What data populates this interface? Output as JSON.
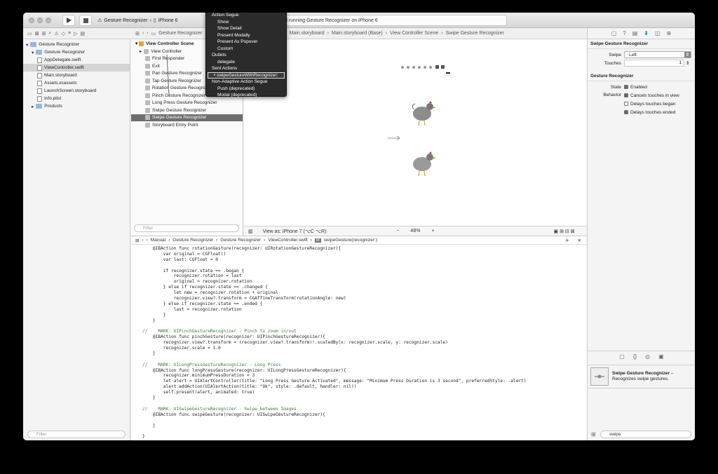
{
  "window": {
    "scheme_project": "Gesture Recognizer",
    "scheme_device": "iPhone 6",
    "status": "d running Gesture Recognizer on iPhone 6"
  },
  "jumpbar_top": {
    "project": "Gesture Recognizer",
    "path": [
      "Main.storyboard",
      "Main.storyboard (Base)",
      "View Controller Scene",
      "Swipe Gesture Recognizer"
    ]
  },
  "navigator": {
    "items": [
      {
        "label": "Gesture Recognizer",
        "level": 0,
        "kind": "project"
      },
      {
        "label": "Gesture Recognizer",
        "level": 1,
        "kind": "folder"
      },
      {
        "label": "AppDelegate.swift",
        "level": 2,
        "kind": "file"
      },
      {
        "label": "ViewController.swift",
        "level": 2,
        "kind": "file",
        "selected": true
      },
      {
        "label": "Main.storyboard",
        "level": 2,
        "kind": "file"
      },
      {
        "label": "Assets.xcassets",
        "level": 2,
        "kind": "file"
      },
      {
        "label": "LaunchScreen.storyboard",
        "level": 2,
        "kind": "file"
      },
      {
        "label": "Info.plist",
        "level": 2,
        "kind": "file"
      },
      {
        "label": "Products",
        "level": 1,
        "kind": "folder"
      }
    ],
    "filter_placeholder": "Filter"
  },
  "outline": {
    "header": "View Controller Scene",
    "items": [
      {
        "label": "View Controller",
        "selected": false
      },
      {
        "label": "First Responder"
      },
      {
        "label": "Exit"
      },
      {
        "label": "Pan Gesture Recognizer"
      },
      {
        "label": "Tap Gesture Recognizer"
      },
      {
        "label": "Rotation Gesture Recognizer"
      },
      {
        "label": "Pinch Gesture Recognizer"
      },
      {
        "label": "Long Press Gesture Recognizer"
      },
      {
        "label": "Swipe Gesture Recognizer"
      },
      {
        "label": "Swipe Gesture Recognizer",
        "selected": true
      },
      {
        "label": "Storyboard Entry Point"
      }
    ],
    "filter_placeholder": "Filter"
  },
  "canvas": {
    "view_as": "View as: iPhone 7 (⌥C ⌥R)",
    "zoom": "48%"
  },
  "menu": {
    "items": [
      {
        "label": "Action Segue",
        "indent": false
      },
      {
        "label": "Show",
        "indent": true
      },
      {
        "label": "Show Detail",
        "indent": true
      },
      {
        "label": "Present Modally",
        "indent": true
      },
      {
        "label": "Present As Popover",
        "indent": true
      },
      {
        "label": "Custom",
        "indent": true
      },
      {
        "label": "Outlets",
        "indent": false
      },
      {
        "label": "delegate",
        "indent": true
      },
      {
        "label": "Sent Actions",
        "indent": false
      },
      {
        "label": "• swipeGestureWithRecognizer:",
        "indent": false,
        "highlight": true
      },
      {
        "label": "Non-Adaptive Action Segue",
        "indent": false
      },
      {
        "label": "Push (deprecated)",
        "indent": true
      },
      {
        "label": "Modal (deprecated)",
        "indent": true
      }
    ]
  },
  "inspector": {
    "section1": "Swipe Gesture Recognizer",
    "swipe_label": "Swipe",
    "swipe_value": "Left",
    "touches_label": "Touches",
    "touches_value": "1",
    "section2": "Gesture Recognizer",
    "state_label": "State",
    "state_value": "Enabled",
    "behavior_label": "Behavior",
    "behaviors": [
      {
        "label": "Cancels touches in view",
        "checked": true
      },
      {
        "label": "Delays touches began",
        "checked": false
      },
      {
        "label": "Delays touches ended",
        "checked": true
      }
    ],
    "library_title": "Swipe Gesture Recognizer",
    "library_title_suffix": " –",
    "library_desc": "Recognizes swipe gestures.",
    "library_search": "swipe"
  },
  "editor": {
    "jumpbar": [
      "Manual",
      "Gesture Recognizer",
      "Gesture Recognizer",
      "ViewController.swift",
      "swipeGesture(recognizer:)"
    ],
    "jumpbar_method_badge": "M",
    "code_lines": [
      "    @IBAction func rotationGesture(recognizer: UIRotationGestureRecognizer){",
      "        var original = CGFloat()",
      "        var last: CGFloat = 0",
      "",
      "        if recognizer.state == .began {",
      "            recognizer.rotation = last",
      "            original = recognizer.rotation",
      "        } else if recognizer.state == .changed {",
      "            let new = recognizer.rotation + original",
      "            recognizer.view?.transform = CGAffineTransform(rotationAngle: new)",
      "        } else if recognizer.state == .ended {",
      "            last = recognizer.rotation",
      "        }",
      "    }",
      "",
      "//    MARK: UIPinchGestureRecognizer - Pinch to zoom in/out",
      "    @IBAction func pinchGesture(recognizer: UIPinchGestureRecognizer){",
      "        recognizer.view?.transform = (recognizer.view?.transform)!.scaledBy(x: recognizer.scale, y: recognizer.scale)",
      "        recognizer.scale = 1.0",
      "    }",
      "",
      "//    MARK: UILongPressGestureRecognizer - Long Press",
      "    @IBAction func longPressGesture(recognizer: UILongPressGestureRecognizer){",
      "        recognizer.minimumPressDuration = 3",
      "        let alert = UIAlertController(title: \"Long Press Gesture Activated\", message: \"Minimum Press Duration is 3 second\", preferredStyle: .alert)",
      "        alert.addAction(UIAlertAction(title: \"Ok\", style: .default, handler: nil))",
      "        self.present(alert, animated: true)",
      "    }",
      "",
      "//    MARK: UISwipeGestureRecognizer - Swipe between Images",
      "    @IBAction func swipeGesture(recognizer: UISwipeGestureRecognizer){",
      "",
      "    }",
      "",
      "}"
    ]
  },
  "colors": {
    "selection_dark": "#6e6e6e",
    "menu_bg": "#2b2b2b",
    "keyword": "#a0306a",
    "comment": "#3e7b3a"
  }
}
